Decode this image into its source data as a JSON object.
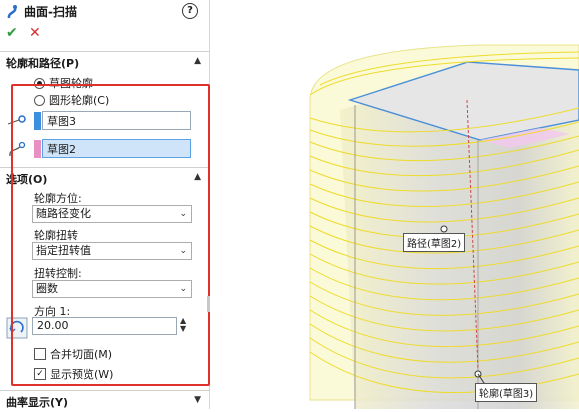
{
  "panel": {
    "title": "曲面-扫描",
    "ok_glyph": "✔",
    "cancel_glyph": "✕",
    "help_glyph": "?",
    "profile_path": {
      "header": "轮廓和路径(P)",
      "option_sketch": "草图轮廓",
      "option_circle": "圆形轮廓(C)",
      "profile_value": "草图3",
      "path_value": "草图2",
      "profile_color": "#3d8fe0",
      "path_color": "#e88fc4"
    },
    "options": {
      "header": "选项(O)",
      "orientation_label": "轮廓方位:",
      "orientation_value": "随路径变化",
      "twist_label": "轮廓扭转",
      "twist_value": "指定扭转值",
      "twist_control_label": "扭转控制:",
      "twist_control_value": "圈数",
      "direction_label": "方向 1:",
      "direction_value": "20.00",
      "merge_faces": "合并切面(M)",
      "show_preview": "显示预览(W)"
    },
    "curvature": {
      "header": "曲率显示(Y)"
    }
  },
  "viewport": {
    "path_callout": "路径(草图2)",
    "profile_callout": "轮廓(草图3)",
    "accent_yellow": "#f4f070",
    "highlight_red": "#e0302a"
  }
}
